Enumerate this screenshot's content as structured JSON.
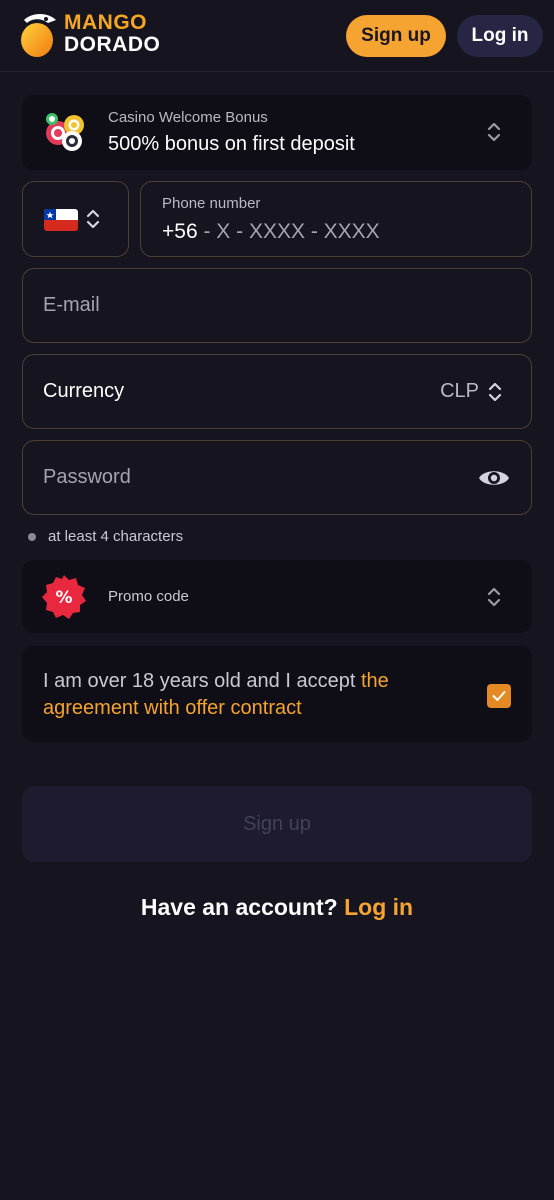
{
  "header": {
    "logo_line1": "MANGO",
    "logo_line2": "DORADO",
    "signup_label": "Sign up",
    "login_label": "Log in"
  },
  "bonus": {
    "label": "Casino Welcome Bonus",
    "value": "500% bonus on first deposit",
    "icon": "casino-chips-icon"
  },
  "phone": {
    "country_flag": "chile-flag-icon",
    "label": "Phone number",
    "prefix": "+56",
    "mask": " - X - XXXX - XXXX"
  },
  "email": {
    "placeholder": "E-mail"
  },
  "currency": {
    "label": "Currency",
    "value": "CLP"
  },
  "password": {
    "placeholder": "Password",
    "hint": "at least 4 characters"
  },
  "promo": {
    "label": "Promo code",
    "icon": "percent-badge-icon"
  },
  "agreement": {
    "text": "I am over 18 years old and I accept ",
    "link": "the agreement with offer contract",
    "checked": true
  },
  "signup_button": {
    "label": "Sign up"
  },
  "footer": {
    "question": "Have an account? ",
    "login_link": "Log in"
  },
  "colors": {
    "background": "#15141f",
    "accent": "#f5a331",
    "card": "#0f0e16",
    "field_border": "#4a3f33",
    "login_button": "#262543"
  }
}
